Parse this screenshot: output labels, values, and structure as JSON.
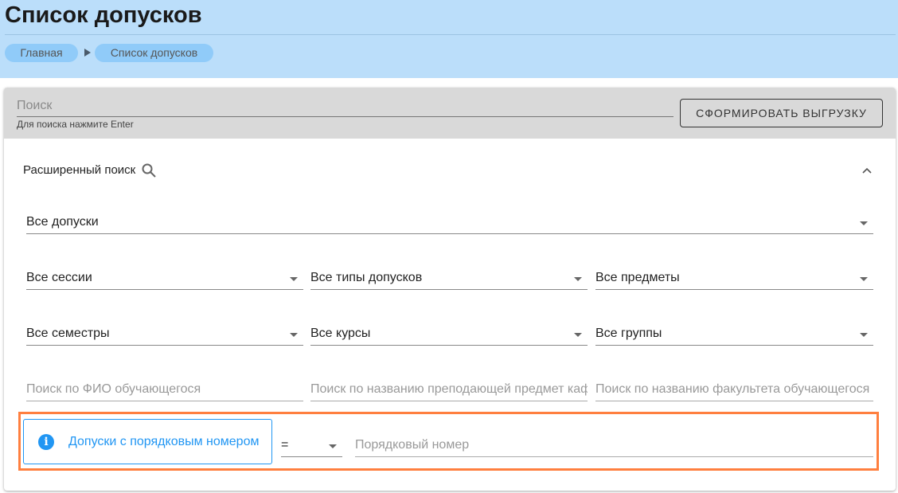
{
  "header": {
    "title": "Список допусков",
    "breadcrumbs": [
      "Главная",
      "Список допусков"
    ]
  },
  "search": {
    "placeholder": "Поиск",
    "hint": "Для поиска нажмите Enter",
    "export_label": "СФОРМИРОВАТЬ ВЫГРУЗКУ"
  },
  "advanced": {
    "label": "Расширенный поиск",
    "selects": {
      "all_admissions": "Все допуски",
      "sessions": "Все сессии",
      "types": "Все типы допусков",
      "subjects": "Все предметы",
      "semesters": "Все семестры",
      "courses": "Все курсы",
      "groups": "Все группы"
    },
    "inputs": {
      "student": "Поиск по ФИО обучающегося",
      "department": "Поиск по названию преподающей предмет кафедры",
      "faculty": "Поиск по названию факультета обучающегося"
    },
    "number_filter": {
      "button_label": "Допуски с порядковым номером",
      "operator": "=",
      "placeholder": "Порядковый номер"
    }
  },
  "colors": {
    "header_bg": "#bbdefa",
    "accent": "#2196f3",
    "highlight": "#ff7f3f"
  }
}
